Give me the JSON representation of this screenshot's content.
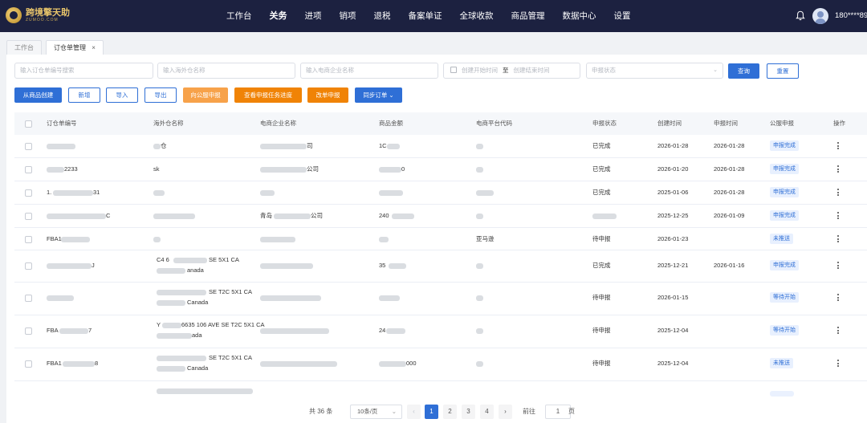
{
  "header": {
    "logo_cn": "跨境擎天助",
    "logo_en": "ZUMOO.COM",
    "nav": [
      "工作台",
      "关务",
      "进项",
      "销项",
      "退税",
      "备案单证",
      "全球收款",
      "商品管理",
      "数据中心",
      "设置"
    ],
    "active_nav": "关务",
    "user": "180****89"
  },
  "tabs": {
    "workbench": "工作台",
    "warehouse_order": "订仓单管理",
    "close": "×"
  },
  "filters": {
    "order_no_placeholder": "输入订仓单编号搜索",
    "warehouse_placeholder": "输入海外仓名称",
    "company_placeholder": "输入电商企业名称",
    "start_placeholder": "创建开始时间",
    "to": "至",
    "end_placeholder": "创建结束时间",
    "status_placeholder": "申报状态",
    "search": "查询",
    "reset": "重置"
  },
  "toolbar": {
    "create_from_goods": "从商品创建",
    "add": "新增",
    "import": "导入",
    "export": "导出",
    "declare_to_platform": "向公服申报",
    "view_progress": "查看申报任务进度",
    "change_declare": "改单申报",
    "sync_orders": "同步订单"
  },
  "table": {
    "columns": [
      "订仓单编号",
      "海外仓名称",
      "电商企业名称",
      "商品金额",
      "电商平台代码",
      "申报状态",
      "创建时间",
      "申报时间",
      "公服申报",
      "操作"
    ],
    "rows": [
      {
        "order_no": "",
        "warehouse": "仓",
        "company": "司",
        "amount": "1C",
        "platform": "",
        "status": "已完成",
        "created": "2026-01-28",
        "declared": "2026-01-28",
        "public": "申报完成"
      },
      {
        "order_no": "2233",
        "warehouse": "sk",
        "company": "公司",
        "amount": "0",
        "platform": "",
        "status": "已完成",
        "created": "2026-01-20",
        "declared": "2026-01-28",
        "public": "申报完成"
      },
      {
        "order_no": "1.",
        "order_no_end": "31",
        "warehouse": "",
        "company": "",
        "amount": "",
        "platform": "",
        "status": "已完成",
        "created": "2025-01-06",
        "declared": "2026-01-28",
        "public": "申报完成"
      },
      {
        "order_no": "C",
        "warehouse": "",
        "company_prefix": "青岛",
        "company": "公司",
        "amount": "240",
        "platform": "",
        "status": "",
        "created": "2025-12-25",
        "declared": "2026-01-09",
        "public": "申报完成"
      },
      {
        "order_no": "FBA1",
        "warehouse": "",
        "company": "",
        "amount": "",
        "platform": "亚马逊",
        "status": "待申报",
        "created": "2026-01-23",
        "declared": "",
        "public": "未推送"
      },
      {
        "order_no": "J",
        "warehouse": "C4 6",
        "warehouse_end": "SE 5X1 CA",
        "warehouse_l2": "anada",
        "company": "",
        "amount": "35",
        "platform": "",
        "status": "已完成",
        "created": "2025-12-21",
        "declared": "2026-01-16",
        "public": "申报完成"
      },
      {
        "order_no": "",
        "warehouse": "SE T2C 5X1 CA",
        "warehouse_l2": "Canada",
        "company": "",
        "amount": "",
        "platform": "",
        "status": "待申报",
        "created": "2026-01-15",
        "declared": "",
        "public": "等待开始"
      },
      {
        "order_no": "FBA",
        "order_no_end": "7",
        "warehouse": "Y",
        "warehouse_end": "6635 106 AVE SE T2C 5X1 CA",
        "warehouse_l2": "ada",
        "company": "",
        "amount": "24",
        "platform": "",
        "status": "待申报",
        "created": "2025-12-04",
        "declared": "",
        "public": "等待开始"
      },
      {
        "order_no": "FBA1",
        "order_no_end": "8",
        "warehouse": "SE T2C 5X1 CA",
        "warehouse_l2": "Canada",
        "company": "",
        "amount": "000",
        "platform": "",
        "status": "待申报",
        "created": "2025-12-04",
        "declared": "",
        "public": "未推送"
      }
    ]
  },
  "pagination": {
    "total": "共 36 条",
    "page_size": "10条/页",
    "pages": [
      "1",
      "2",
      "3",
      "4"
    ],
    "current": "1",
    "goto_label": "前往",
    "goto_value": "1",
    "page_unit": "页",
    "prev": "‹",
    "next": "›"
  },
  "colors": {
    "topbar": "#1c2140",
    "primary": "#2f6fd6",
    "orange": "#f08306",
    "light_orange": "#f7a24a"
  }
}
